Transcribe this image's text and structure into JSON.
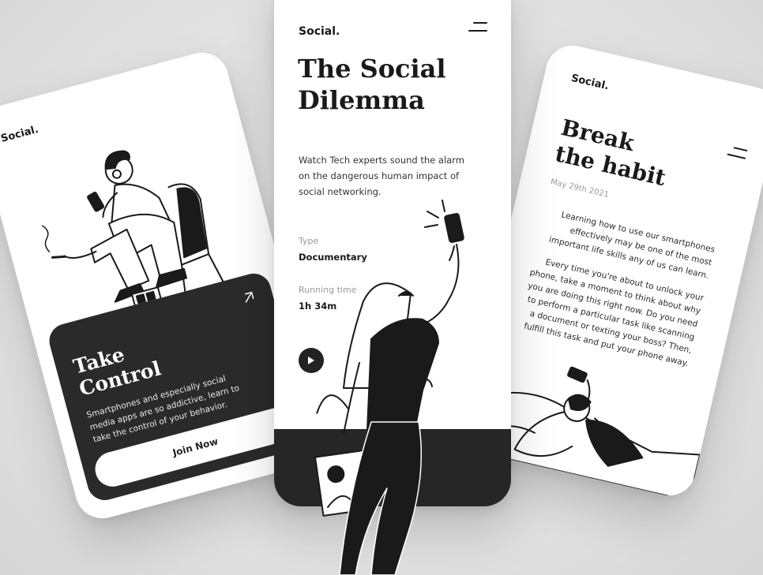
{
  "brand": "Social.",
  "left_screen": {
    "card_title": "Take\nControl",
    "card_text": "Smartphones and especially social media apps are so addictive, learn to take the control of your behavior.",
    "button_label": "Join Now"
  },
  "middle_screen": {
    "title": "The Social\nDilemma",
    "description": "Watch Tech experts sound the alarm on the dangerous human impact of social networking.",
    "type_label": "Type",
    "type_value": "Documentary",
    "running_label": "Running time",
    "running_value": "1h 34m"
  },
  "right_screen": {
    "title": "Break\nthe habit",
    "date": "May 29th 2021",
    "paragraph_1": "Learning how to use our smartphones effectively may be one of the most important life skills any of us can learn.",
    "paragraph_2": "Every time you're about to unlock your phone, take a moment to think about why you are doing this right now. Do you need to perform a particular task like scanning a document or texting your boss? Then, fulfill this task and put your phone away."
  },
  "icons": {
    "menu": "hamburger-icon",
    "arrow": "arrow-up-right-icon",
    "play": "play-icon"
  },
  "colors": {
    "dark": "#262626",
    "light": "#ffffff",
    "background": "#e3e3e3"
  }
}
